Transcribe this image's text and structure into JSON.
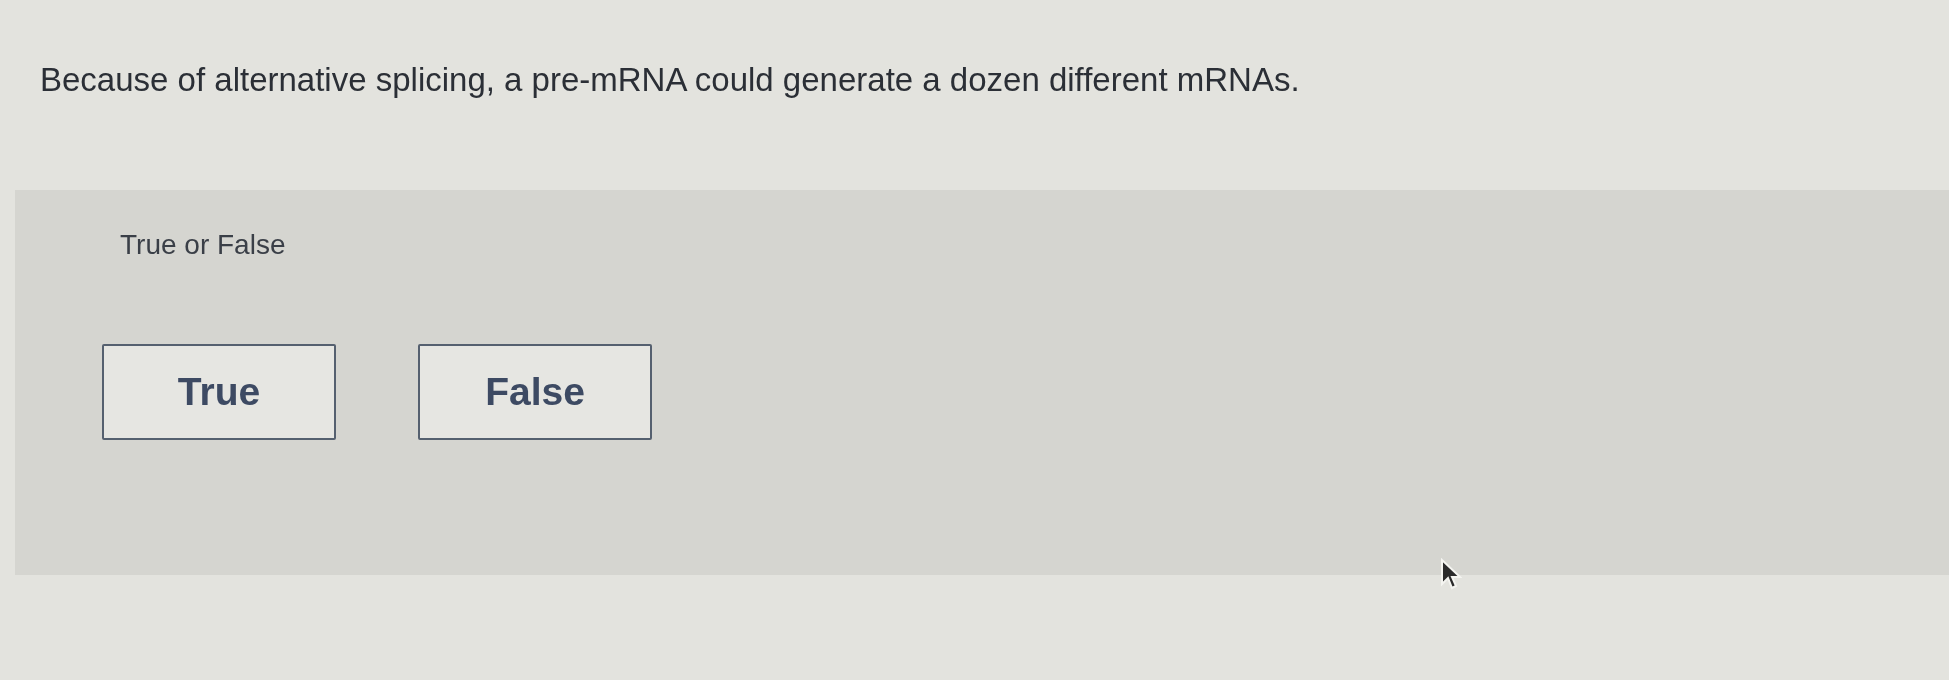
{
  "question": {
    "text": "Because of alternative splicing, a pre-mRNA could generate a dozen different mRNAs."
  },
  "answer_panel": {
    "prompt": "True or False",
    "options": [
      {
        "label": "True",
        "selected": false
      },
      {
        "label": "False",
        "selected": false
      }
    ]
  }
}
